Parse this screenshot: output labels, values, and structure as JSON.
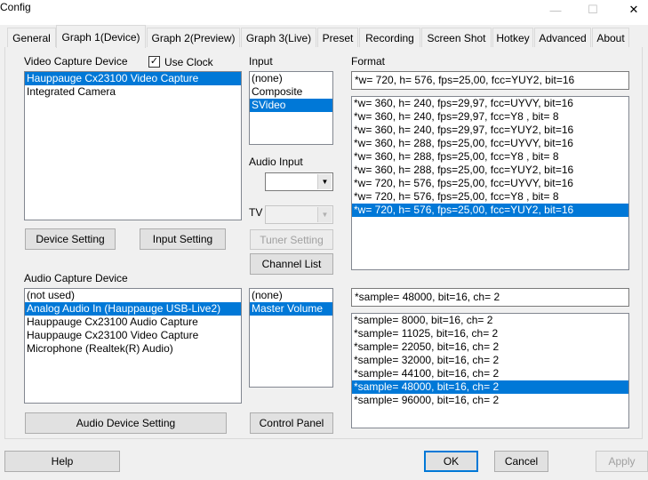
{
  "window": {
    "title": "Config",
    "minimize_glyph": "—",
    "maximize_glyph": "☐",
    "close_glyph": "✕"
  },
  "tabs": [
    {
      "label": "General"
    },
    {
      "label": "Graph 1(Device)"
    },
    {
      "label": "Graph 2(Preview)"
    },
    {
      "label": "Graph 3(Live)"
    },
    {
      "label": "Preset"
    },
    {
      "label": "Recording"
    },
    {
      "label": "Screen Shot"
    },
    {
      "label": "Hotkey"
    },
    {
      "label": "Advanced"
    },
    {
      "label": "About"
    }
  ],
  "video_capture": {
    "label": "Video Capture Device",
    "use_clock_label": "Use Clock",
    "use_clock_checked": "✓",
    "devices": [
      "Hauppauge Cx23100 Video Capture",
      "Integrated Camera"
    ],
    "device_setting_button": "Device Setting",
    "input_setting_button": "Input Setting"
  },
  "input": {
    "label": "Input",
    "items": [
      "(none)",
      "Composite",
      "SVideo"
    ],
    "audio_input_label": "Audio Input",
    "tv_label": "TV",
    "tuner_setting_button": "Tuner Setting",
    "channel_list_button": "Channel List"
  },
  "format": {
    "label": "Format",
    "current": "*w= 720, h= 576, fps=25,00,  fcc=YUY2, bit=16",
    "items": [
      "*w= 360, h= 240, fps=29,97,  fcc=UYVY, bit=16",
      "*w= 360, h= 240, fps=29,97,  fcc=Y8  , bit= 8",
      "*w= 360, h= 240, fps=29,97,  fcc=YUY2, bit=16",
      "*w= 360, h= 288, fps=25,00,  fcc=UYVY, bit=16",
      "*w= 360, h= 288, fps=25,00,  fcc=Y8  , bit= 8",
      "*w= 360, h= 288, fps=25,00,  fcc=YUY2, bit=16",
      "*w= 720, h= 576, fps=25,00,  fcc=UYVY, bit=16",
      "*w= 720, h= 576, fps=25,00,  fcc=Y8  , bit= 8",
      "*w= 720, h= 576, fps=25,00,  fcc=YUY2, bit=16"
    ]
  },
  "audio_capture": {
    "label": "Audio Capture Device",
    "devices": [
      "(not used)",
      "Analog Audio In (Hauppauge USB-Live2)",
      "Hauppauge Cx23100 Audio Capture",
      "Hauppauge Cx23100 Video Capture",
      "Microphone (Realtek(R) Audio)"
    ],
    "audio_device_setting_button": "Audio Device Setting",
    "mixer_items": [
      "(none)",
      "Master Volume"
    ],
    "control_panel_button": "Control Panel",
    "sample_current": "*sample= 48000, bit=16, ch= 2",
    "sample_items": [
      "*sample=  8000, bit=16, ch= 2",
      "*sample= 11025, bit=16, ch= 2",
      "*sample= 22050, bit=16, ch= 2",
      "*sample= 32000, bit=16, ch= 2",
      "*sample= 44100, bit=16, ch= 2",
      "*sample= 48000, bit=16, ch= 2",
      "*sample= 96000, bit=16, ch= 2"
    ]
  },
  "footer": {
    "help_button": "Help",
    "ok_button": "OK",
    "cancel_button": "Cancel",
    "apply_button": "Apply"
  },
  "colors": {
    "selection": "#0078d7",
    "window_bg": "#f0f0f0"
  }
}
